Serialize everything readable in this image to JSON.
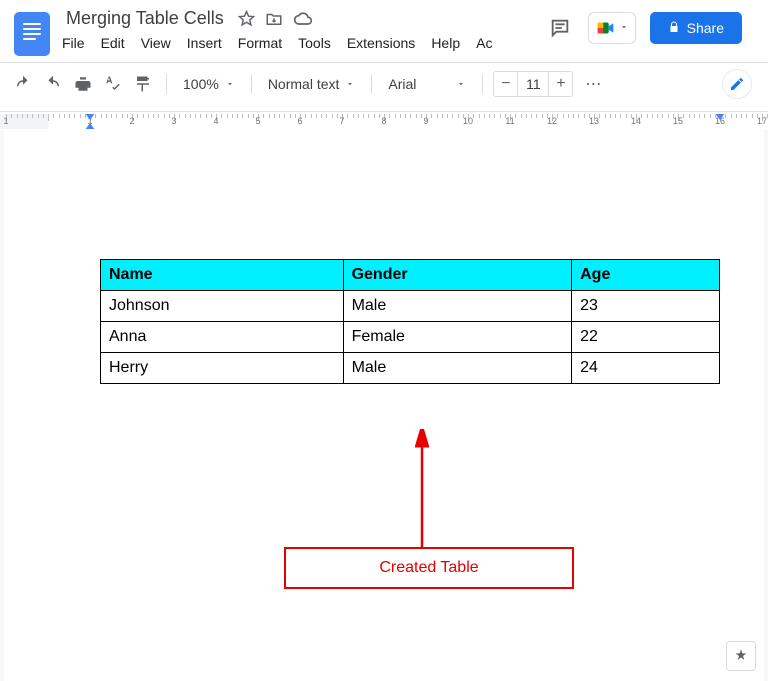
{
  "header": {
    "doc_title": "Merging Table Cells",
    "share_label": "Share",
    "menus": [
      "File",
      "Edit",
      "View",
      "Insert",
      "Format",
      "Tools",
      "Extensions",
      "Help",
      "Ac"
    ]
  },
  "toolbar": {
    "zoom": "100%",
    "style": "Normal text",
    "font": "Arial",
    "fontsize": "11"
  },
  "table": {
    "headers": [
      "Name",
      "Gender",
      "Age"
    ],
    "rows": [
      [
        "Johnson",
        "Male",
        "23"
      ],
      [
        "Anna",
        "Female",
        "22"
      ],
      [
        "Herry",
        "Male",
        "24"
      ]
    ]
  },
  "annotation": {
    "label": "Created Table"
  }
}
